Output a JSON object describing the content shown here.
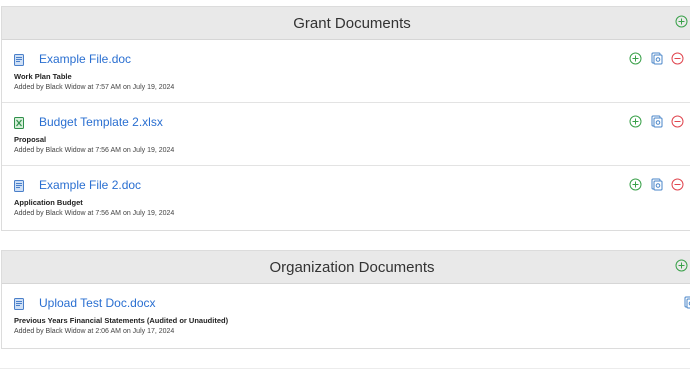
{
  "grant_section": {
    "title": "Grant Documents",
    "documents": [
      {
        "file_name": "Example File.doc",
        "file_type_icon": "word-doc-icon",
        "doc_type": "Work Plan Table",
        "added": "Added by Black Widow at 7:57 AM on July 19, 2024"
      },
      {
        "file_name": "Budget Template 2.xlsx",
        "file_type_icon": "excel-doc-icon",
        "doc_type": "Proposal",
        "added": "Added by Black Widow at 7:56 AM on July 19, 2024"
      },
      {
        "file_name": "Example File 2.doc",
        "file_type_icon": "word-doc-icon",
        "doc_type": "Application Budget",
        "added": "Added by Black Widow at 7:56 AM on July 19, 2024"
      }
    ]
  },
  "organization_section": {
    "title": "Organization Documents",
    "documents": [
      {
        "file_name": "Upload Test Doc.docx",
        "file_type_icon": "word-doc-icon",
        "doc_type": "Previous Years Financial Statements (Audited or Unaudited)",
        "added": "Added by Black Widow at 2:06 AM on July 17, 2024"
      }
    ]
  },
  "colors": {
    "link": "#2a6fd1",
    "add_green": "#3aa14a",
    "remove_red": "#e0464f",
    "version_blue": "#4a86c9",
    "header_bg": "#e9e9e9"
  },
  "icons": {
    "add": "plus-circle-icon",
    "versions": "version-history-icon",
    "remove": "minus-circle-icon"
  }
}
